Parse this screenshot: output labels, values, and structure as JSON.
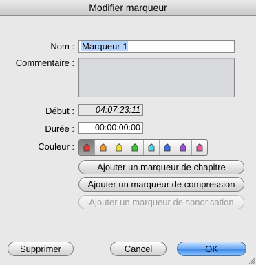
{
  "window": {
    "title": "Modifier marqueur"
  },
  "form": {
    "name_label": "Nom :",
    "name_value": "Marqueur 1",
    "comment_label": "Commentaire :",
    "comment_value": "",
    "start_label": "Début :",
    "start_value": "04:07:23:11",
    "duration_label": "Durée :",
    "duration_value": "00:00:00:00",
    "color_label": "Couleur :",
    "colors": [
      {
        "name": "red",
        "hex": "#e23a3a",
        "selected": true
      },
      {
        "name": "orange",
        "hex": "#f39a32"
      },
      {
        "name": "yellow",
        "hex": "#efe033"
      },
      {
        "name": "green",
        "hex": "#3dc33d"
      },
      {
        "name": "cyan",
        "hex": "#4fd3e6"
      },
      {
        "name": "blue",
        "hex": "#3b6fe0"
      },
      {
        "name": "purple",
        "hex": "#9a4fd6"
      },
      {
        "name": "pink",
        "hex": "#ee5aa0"
      }
    ]
  },
  "actions": {
    "chapter": "Ajouter un marqueur de chapitre",
    "compression": "Ajouter un marqueur de compression",
    "scoring": "Ajouter un marqueur de sonorisation"
  },
  "footer": {
    "delete": "Supprimer",
    "cancel": "Cancel",
    "ok": "OK"
  }
}
